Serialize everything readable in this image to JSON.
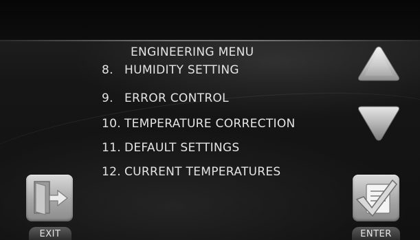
{
  "menu": {
    "title": "ENGINEERING MENU",
    "items": [
      {
        "number": "8.",
        "label": "HUMIDITY SETTING"
      },
      {
        "number": "9.",
        "label": "ERROR CONTROL"
      },
      {
        "number": "10.",
        "label": "TEMPERATURE CORRECTION"
      },
      {
        "number": "11.",
        "label": "DEFAULT SETTINGS"
      },
      {
        "number": "12.",
        "label": "CURRENT TEMPERATURES"
      }
    ]
  },
  "buttons": {
    "exit_label": "EXIT",
    "enter_label": "ENTER",
    "up_icon": "triangle-up-icon",
    "down_icon": "triangle-down-icon",
    "exit_icon": "door-exit-icon",
    "enter_icon": "checklist-check-icon"
  }
}
